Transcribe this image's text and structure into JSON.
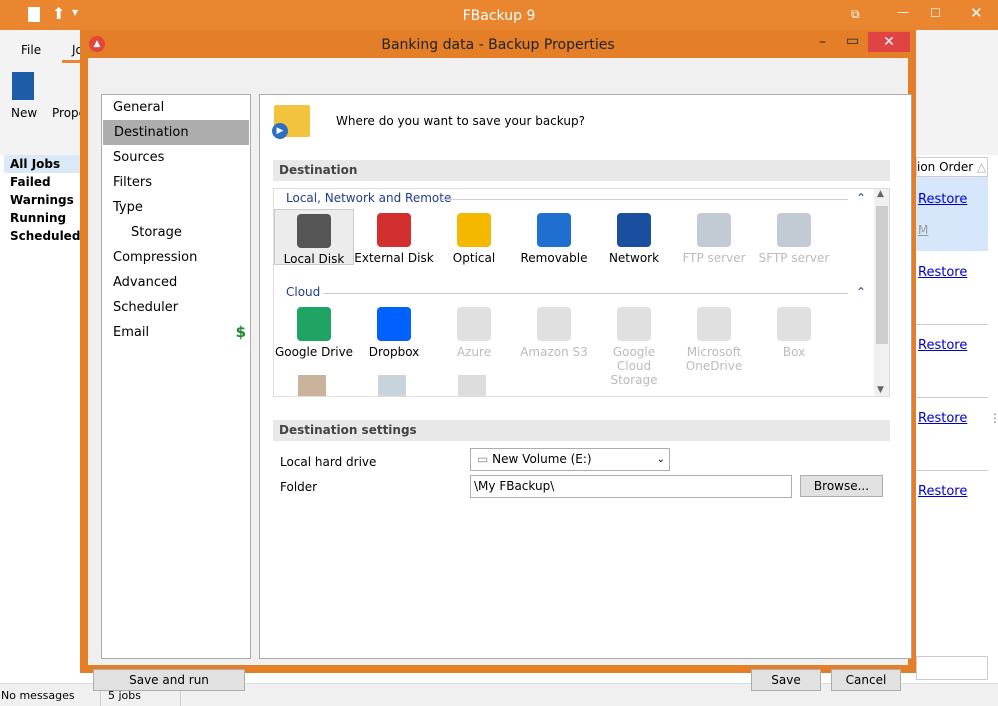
{
  "app": {
    "title": "FBackup 9",
    "menu": [
      "File",
      "Jo"
    ],
    "ribbon": [
      "New",
      "Prope"
    ],
    "jobs_filter": [
      "All Jobs",
      "Failed",
      "Warnings",
      "Running",
      "Scheduled"
    ],
    "column_header": "ion Order",
    "restore_label": "Restore",
    "partial_text": "M",
    "status": {
      "messages": "No messages",
      "jobs": "5 jobs"
    }
  },
  "dialog": {
    "title": "Banking data - Backup Properties",
    "nav": [
      "General",
      "Destination",
      "Sources",
      "Filters",
      "Type",
      "Storage",
      "Compression",
      "Advanced",
      "Scheduler",
      "Email"
    ],
    "selected_nav": "Destination",
    "question": "Where do you want to save your backup?",
    "destination_section": "Destination",
    "groups": {
      "local": "Local, Network and Remote",
      "cloud": "Cloud"
    },
    "local_items": [
      {
        "label": "Local Disk",
        "enabled": true,
        "color": "#555"
      },
      {
        "label": "External Disk",
        "enabled": true,
        "color": "#d32f2f"
      },
      {
        "label": "Optical",
        "enabled": true,
        "color": "#f5b800"
      },
      {
        "label": "Removable",
        "enabled": true,
        "color": "#1e6fd0"
      },
      {
        "label": "Network",
        "enabled": true,
        "color": "#1a4fa0"
      },
      {
        "label": "FTP server",
        "enabled": false,
        "color": "#9aa6b6"
      },
      {
        "label": "SFTP server",
        "enabled": false,
        "color": "#9aa6b6"
      }
    ],
    "cloud_items": [
      {
        "label": "Google Drive",
        "enabled": true,
        "color": "#1fa463"
      },
      {
        "label": "Dropbox",
        "enabled": true,
        "color": "#0061fe"
      },
      {
        "label": "Azure",
        "enabled": false,
        "color": "#ccc"
      },
      {
        "label": "Amazon S3",
        "enabled": false,
        "color": "#ccc"
      },
      {
        "label": "Google Cloud Storage",
        "enabled": false,
        "color": "#ccc"
      },
      {
        "label": "Microsoft OneDrive",
        "enabled": false,
        "color": "#ccc"
      },
      {
        "label": "Box",
        "enabled": false,
        "color": "#ccc"
      }
    ],
    "settings_section": "Destination settings",
    "drive_label": "Local hard drive",
    "drive_value": "New Volume (E:)",
    "folder_label": "Folder",
    "folder_value": "\\My FBackup\\",
    "browse": "Browse...",
    "save_and_run": "Save and run",
    "save": "Save",
    "cancel": "Cancel"
  }
}
